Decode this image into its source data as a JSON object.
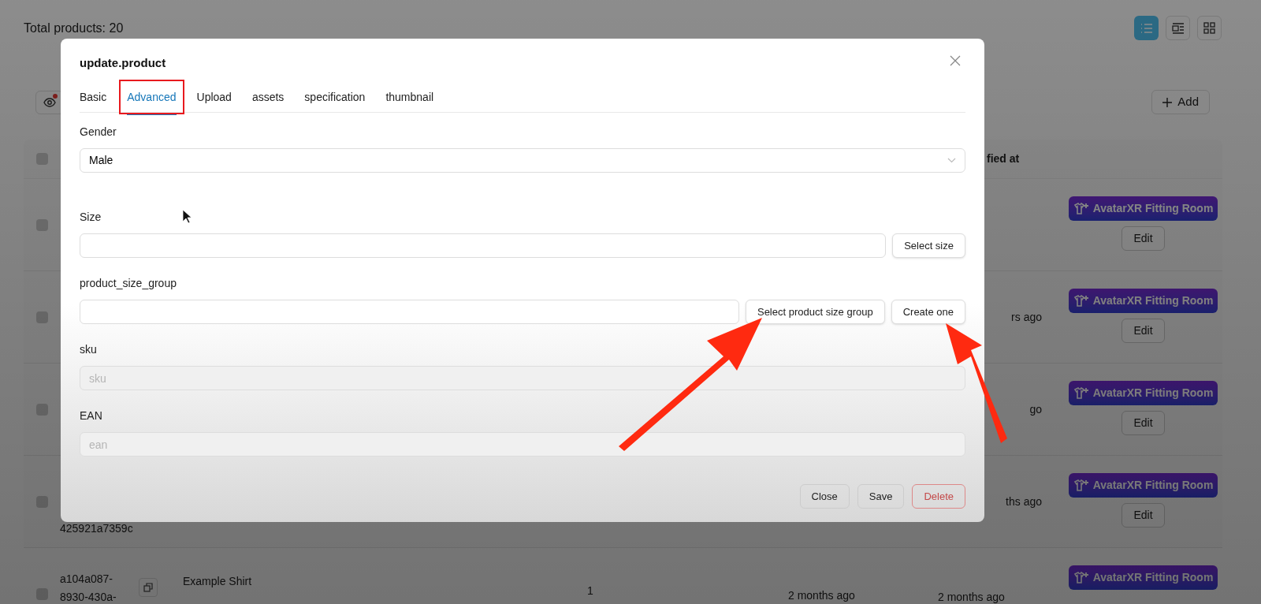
{
  "page": {
    "total": "Total products: 20",
    "view_buttons": [
      {
        "kind": "list",
        "selected": true
      },
      {
        "kind": "detail",
        "selected": false
      },
      {
        "kind": "grid",
        "selected": false
      }
    ],
    "filter_button": {
      "dot": true
    },
    "add_button": "Add",
    "table": {
      "header_checked": false,
      "header_last": "fied at",
      "rows": [
        {
          "checked": false,
          "modified": "",
          "fitting": "AvatarXR Fitting Room",
          "edit": "Edit"
        },
        {
          "checked": false,
          "modified": "rs ago",
          "fitting": "AvatarXR Fitting Room",
          "edit": "Edit"
        },
        {
          "checked": false,
          "modified": "go",
          "fitting": "AvatarXR Fitting Room",
          "edit": "Edit"
        },
        {
          "checked": false,
          "id_lines": [
            "425921a7359c"
          ],
          "modified": "ths ago",
          "fitting": "AvatarXR Fitting Room",
          "edit": "Edit"
        },
        {
          "checked": false,
          "id_lines": [
            "a104a087-",
            "8930-430a-"
          ],
          "name": "Example Shirt",
          "qty": "1",
          "created": "2 months ago",
          "modified": "2 months ago",
          "fitting": "AvatarXR Fitting Room"
        }
      ]
    }
  },
  "modal": {
    "title": "update.product",
    "tabs": [
      {
        "label": "Basic",
        "selected": false,
        "highlighted": false
      },
      {
        "label": "Advanced",
        "selected": true,
        "highlighted": true
      },
      {
        "label": "Upload",
        "selected": false,
        "highlighted": false
      },
      {
        "label": "assets",
        "selected": false,
        "highlighted": false
      },
      {
        "label": "specification",
        "selected": false,
        "highlighted": false
      },
      {
        "label": "thumbnail",
        "selected": false,
        "highlighted": false
      }
    ],
    "fields": [
      {
        "kind": "select",
        "label": "Gender",
        "value": "Male"
      },
      {
        "kind": "input_buttons",
        "label": "Size",
        "buttons": [
          "Select size"
        ]
      },
      {
        "kind": "input_buttons",
        "label": "product_size_group",
        "buttons": [
          "Select product size group",
          "Create one"
        ]
      },
      {
        "kind": "disabled",
        "label": "sku",
        "placeholder": "sku"
      },
      {
        "kind": "disabled",
        "label": "EAN",
        "placeholder": "ean"
      }
    ],
    "footer": [
      {
        "label": "Close",
        "kind": "default"
      },
      {
        "label": "Save",
        "kind": "default"
      },
      {
        "label": "Delete",
        "kind": "danger"
      }
    ]
  }
}
